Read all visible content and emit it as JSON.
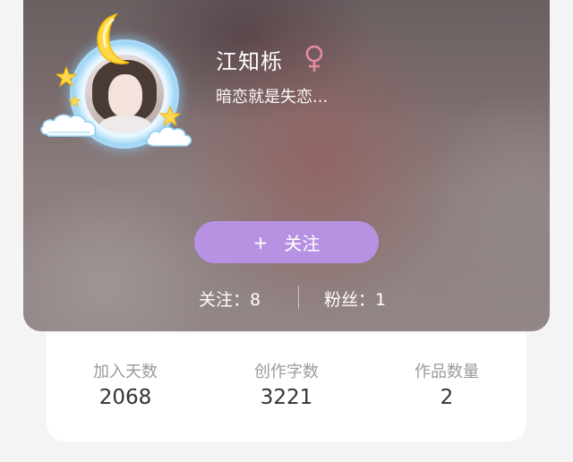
{
  "profile": {
    "name": "江知栎",
    "gender_icon": "female-symbol",
    "signature": "暗恋就是失恋..."
  },
  "follow_button": {
    "icon": "+",
    "label": "关注"
  },
  "social": {
    "following_label": "关注：",
    "following_count": "8",
    "fans_label": "粉丝：",
    "fans_count": "1"
  },
  "stats": [
    {
      "label": "加入天数",
      "value": "2068"
    },
    {
      "label": "创作字数",
      "value": "3221"
    },
    {
      "label": "作品数量",
      "value": "2"
    }
  ],
  "colors": {
    "accent": "#b792e2",
    "gender": "#e58ca3"
  }
}
